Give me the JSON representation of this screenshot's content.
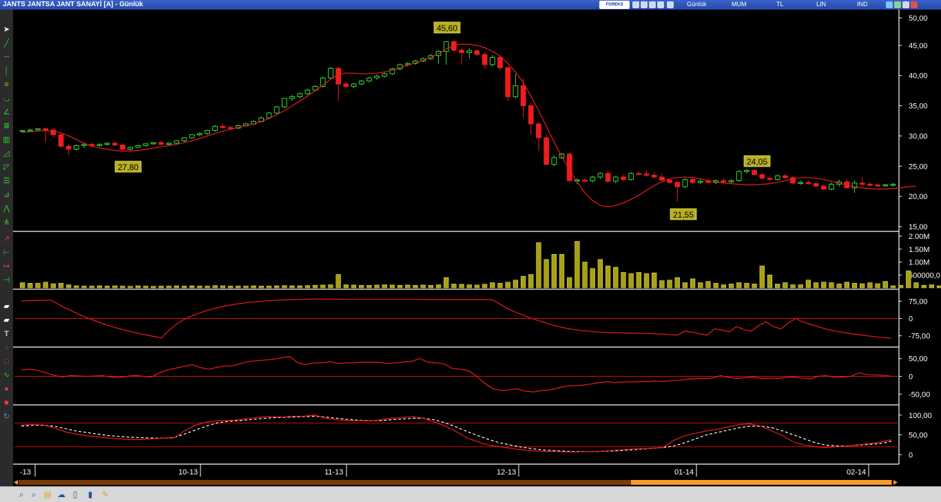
{
  "window": {
    "title": "JANTS JANTSA JANT SANAYİ [A] - Günlük",
    "brand": "FOREKS",
    "menu": [
      "Günlük",
      "MUM",
      "TL",
      "LIN",
      "IND"
    ]
  },
  "chart_data": {
    "type": "candlestick",
    "ylim": [
      15,
      50
    ],
    "price_ticks": [
      "50,00",
      "45,00",
      "40,00",
      "35,00",
      "30,00",
      "25,00",
      "20,00",
      "15,00"
    ],
    "x_ticks": [
      "-13",
      "10-13",
      "11-13",
      "12-13",
      "01-14",
      "02-14"
    ],
    "annotations": [
      "45,60",
      "27,80",
      "24,05",
      "21,55"
    ],
    "candles": [
      {
        "o": 30.8,
        "h": 31.0,
        "l": 30.5,
        "c": 30.9
      },
      {
        "o": 30.9,
        "h": 31.2,
        "l": 30.6,
        "c": 31.0
      },
      {
        "o": 31.0,
        "h": 31.3,
        "l": 30.8,
        "c": 31.2
      },
      {
        "o": 31.2,
        "h": 31.4,
        "l": 29.0,
        "c": 31.0
      },
      {
        "o": 31.0,
        "h": 31.3,
        "l": 29.8,
        "c": 30.2
      },
      {
        "o": 30.2,
        "h": 30.5,
        "l": 28.0,
        "c": 28.3
      },
      {
        "o": 28.3,
        "h": 28.6,
        "l": 26.8,
        "c": 27.8
      },
      {
        "o": 27.8,
        "h": 28.6,
        "l": 27.6,
        "c": 28.4
      },
      {
        "o": 28.4,
        "h": 28.8,
        "l": 28.0,
        "c": 28.6
      },
      {
        "o": 28.6,
        "h": 28.9,
        "l": 28.2,
        "c": 28.4
      },
      {
        "o": 28.4,
        "h": 28.8,
        "l": 28.2,
        "c": 28.6
      },
      {
        "o": 28.6,
        "h": 28.9,
        "l": 28.4,
        "c": 28.8
      },
      {
        "o": 28.8,
        "h": 29.2,
        "l": 28.3,
        "c": 28.5
      },
      {
        "o": 28.5,
        "h": 28.8,
        "l": 27.6,
        "c": 27.8
      },
      {
        "o": 27.8,
        "h": 28.3,
        "l": 27.6,
        "c": 28.1
      },
      {
        "o": 28.1,
        "h": 28.6,
        "l": 28.0,
        "c": 28.4
      },
      {
        "o": 28.4,
        "h": 28.8,
        "l": 28.2,
        "c": 28.7
      },
      {
        "o": 28.7,
        "h": 29.0,
        "l": 28.5,
        "c": 28.9
      },
      {
        "o": 28.9,
        "h": 29.2,
        "l": 28.5,
        "c": 28.6
      },
      {
        "o": 28.6,
        "h": 28.9,
        "l": 28.4,
        "c": 28.8
      },
      {
        "o": 28.8,
        "h": 29.3,
        "l": 28.7,
        "c": 29.2
      },
      {
        "o": 29.2,
        "h": 29.8,
        "l": 29.0,
        "c": 29.7
      },
      {
        "o": 29.7,
        "h": 30.3,
        "l": 29.5,
        "c": 30.2
      },
      {
        "o": 30.2,
        "h": 30.6,
        "l": 29.9,
        "c": 30.4
      },
      {
        "o": 30.4,
        "h": 31.0,
        "l": 30.2,
        "c": 30.9
      },
      {
        "o": 30.9,
        "h": 31.8,
        "l": 30.7,
        "c": 31.6
      },
      {
        "o": 31.6,
        "h": 32.0,
        "l": 31.2,
        "c": 31.4
      },
      {
        "o": 31.4,
        "h": 31.7,
        "l": 31.0,
        "c": 31.3
      },
      {
        "o": 31.3,
        "h": 31.9,
        "l": 31.1,
        "c": 31.7
      },
      {
        "o": 31.7,
        "h": 32.2,
        "l": 31.5,
        "c": 32.0
      },
      {
        "o": 32.0,
        "h": 32.6,
        "l": 31.8,
        "c": 32.4
      },
      {
        "o": 32.4,
        "h": 33.2,
        "l": 32.2,
        "c": 33.0
      },
      {
        "o": 33.0,
        "h": 34.0,
        "l": 32.8,
        "c": 33.8
      },
      {
        "o": 33.8,
        "h": 35.0,
        "l": 33.6,
        "c": 34.8
      },
      {
        "o": 34.8,
        "h": 36.3,
        "l": 34.6,
        "c": 36.2
      },
      {
        "o": 36.2,
        "h": 36.8,
        "l": 35.8,
        "c": 36.5
      },
      {
        "o": 36.5,
        "h": 37.2,
        "l": 36.2,
        "c": 37.0
      },
      {
        "o": 37.0,
        "h": 37.8,
        "l": 36.8,
        "c": 37.6
      },
      {
        "o": 37.6,
        "h": 38.4,
        "l": 37.4,
        "c": 38.2
      },
      {
        "o": 38.2,
        "h": 39.8,
        "l": 38.0,
        "c": 39.6
      },
      {
        "o": 39.6,
        "h": 41.4,
        "l": 39.4,
        "c": 41.2
      },
      {
        "o": 41.2,
        "h": 41.5,
        "l": 35.8,
        "c": 38.6
      },
      {
        "o": 38.6,
        "h": 39.0,
        "l": 37.8,
        "c": 38.2
      },
      {
        "o": 38.2,
        "h": 38.8,
        "l": 37.9,
        "c": 38.6
      },
      {
        "o": 38.6,
        "h": 39.3,
        "l": 38.4,
        "c": 39.1
      },
      {
        "o": 39.1,
        "h": 39.8,
        "l": 38.9,
        "c": 39.6
      },
      {
        "o": 39.6,
        "h": 40.2,
        "l": 39.3,
        "c": 39.9
      },
      {
        "o": 39.9,
        "h": 40.5,
        "l": 39.7,
        "c": 40.3
      },
      {
        "o": 40.3,
        "h": 41.3,
        "l": 40.1,
        "c": 41.1
      },
      {
        "o": 41.1,
        "h": 42.0,
        "l": 40.9,
        "c": 41.8
      },
      {
        "o": 41.8,
        "h": 42.3,
        "l": 41.5,
        "c": 42.0
      },
      {
        "o": 42.0,
        "h": 42.6,
        "l": 41.8,
        "c": 42.4
      },
      {
        "o": 42.4,
        "h": 43.0,
        "l": 42.2,
        "c": 42.8
      },
      {
        "o": 42.8,
        "h": 43.6,
        "l": 42.6,
        "c": 43.3
      },
      {
        "o": 43.3,
        "h": 44.2,
        "l": 42.0,
        "c": 44.0
      },
      {
        "o": 44.0,
        "h": 45.7,
        "l": 41.8,
        "c": 45.6
      },
      {
        "o": 45.6,
        "h": 45.8,
        "l": 43.8,
        "c": 44.2
      },
      {
        "o": 44.2,
        "h": 44.6,
        "l": 41.8,
        "c": 43.8
      },
      {
        "o": 43.8,
        "h": 44.5,
        "l": 42.8,
        "c": 44.1
      },
      {
        "o": 44.1,
        "h": 44.4,
        "l": 43.2,
        "c": 43.5
      },
      {
        "o": 43.5,
        "h": 43.8,
        "l": 41.2,
        "c": 41.8
      },
      {
        "o": 41.8,
        "h": 43.4,
        "l": 41.5,
        "c": 43.0
      },
      {
        "o": 43.0,
        "h": 43.3,
        "l": 40.8,
        "c": 41.3
      },
      {
        "o": 41.3,
        "h": 41.6,
        "l": 35.8,
        "c": 36.5
      },
      {
        "o": 36.5,
        "h": 40.3,
        "l": 36.2,
        "c": 38.3
      },
      {
        "o": 38.3,
        "h": 39.5,
        "l": 33.0,
        "c": 35.0
      },
      {
        "o": 35.0,
        "h": 35.5,
        "l": 30.2,
        "c": 32.0
      },
      {
        "o": 32.0,
        "h": 32.4,
        "l": 27.5,
        "c": 29.7
      },
      {
        "o": 29.7,
        "h": 30.2,
        "l": 25.2,
        "c": 25.3
      },
      {
        "o": 25.3,
        "h": 26.8,
        "l": 25.0,
        "c": 26.4
      },
      {
        "o": 26.4,
        "h": 27.2,
        "l": 26.2,
        "c": 27.0
      },
      {
        "o": 27.0,
        "h": 27.3,
        "l": 22.3,
        "c": 22.6
      },
      {
        "o": 22.6,
        "h": 23.0,
        "l": 22.0,
        "c": 22.7
      },
      {
        "o": 22.7,
        "h": 23.0,
        "l": 22.3,
        "c": 22.6
      },
      {
        "o": 22.6,
        "h": 23.4,
        "l": 22.3,
        "c": 23.2
      },
      {
        "o": 23.2,
        "h": 24.0,
        "l": 22.9,
        "c": 23.8
      },
      {
        "o": 23.8,
        "h": 24.2,
        "l": 22.2,
        "c": 22.5
      },
      {
        "o": 22.5,
        "h": 23.4,
        "l": 22.2,
        "c": 23.2
      },
      {
        "o": 23.2,
        "h": 23.6,
        "l": 22.5,
        "c": 22.8
      },
      {
        "o": 22.8,
        "h": 24.0,
        "l": 22.6,
        "c": 23.8
      },
      {
        "o": 23.8,
        "h": 24.1,
        "l": 23.5,
        "c": 23.7
      },
      {
        "o": 23.7,
        "h": 24.3,
        "l": 23.2,
        "c": 23.5
      },
      {
        "o": 23.5,
        "h": 24.0,
        "l": 23.0,
        "c": 23.2
      },
      {
        "o": 23.2,
        "h": 23.8,
        "l": 22.5,
        "c": 22.7
      },
      {
        "o": 22.7,
        "h": 23.0,
        "l": 22.0,
        "c": 22.3
      },
      {
        "o": 22.3,
        "h": 22.6,
        "l": 19.2,
        "c": 21.6
      },
      {
        "o": 21.6,
        "h": 23.0,
        "l": 21.4,
        "c": 22.8
      },
      {
        "o": 22.8,
        "h": 23.2,
        "l": 22.0,
        "c": 22.3
      },
      {
        "o": 22.3,
        "h": 22.8,
        "l": 22.0,
        "c": 22.5
      },
      {
        "o": 22.5,
        "h": 23.0,
        "l": 22.1,
        "c": 22.3
      },
      {
        "o": 22.3,
        "h": 22.8,
        "l": 22.0,
        "c": 22.6
      },
      {
        "o": 22.6,
        "h": 23.0,
        "l": 22.2,
        "c": 22.4
      },
      {
        "o": 22.4,
        "h": 22.8,
        "l": 22.1,
        "c": 22.6
      },
      {
        "o": 22.6,
        "h": 24.4,
        "l": 22.4,
        "c": 24.1
      },
      {
        "o": 24.1,
        "h": 24.5,
        "l": 23.8,
        "c": 24.3
      },
      {
        "o": 24.3,
        "h": 24.5,
        "l": 23.4,
        "c": 23.6
      },
      {
        "o": 23.6,
        "h": 23.9,
        "l": 22.8,
        "c": 23.0
      },
      {
        "o": 23.0,
        "h": 23.4,
        "l": 22.5,
        "c": 22.8
      },
      {
        "o": 22.8,
        "h": 23.6,
        "l": 22.6,
        "c": 23.4
      },
      {
        "o": 23.4,
        "h": 23.7,
        "l": 22.9,
        "c": 23.1
      },
      {
        "o": 23.1,
        "h": 23.4,
        "l": 22.0,
        "c": 22.2
      },
      {
        "o": 22.2,
        "h": 22.6,
        "l": 21.9,
        "c": 22.3
      },
      {
        "o": 22.3,
        "h": 22.6,
        "l": 21.9,
        "c": 22.1
      },
      {
        "o": 22.1,
        "h": 22.4,
        "l": 21.5,
        "c": 21.7
      },
      {
        "o": 21.7,
        "h": 21.9,
        "l": 21.0,
        "c": 21.2
      },
      {
        "o": 21.2,
        "h": 22.3,
        "l": 21.0,
        "c": 22.0
      },
      {
        "o": 22.0,
        "h": 22.8,
        "l": 21.6,
        "c": 22.4
      },
      {
        "o": 22.4,
        "h": 22.8,
        "l": 21.3,
        "c": 21.4
      },
      {
        "o": 21.4,
        "h": 22.6,
        "l": 20.6,
        "c": 22.2
      },
      {
        "o": 22.2,
        "h": 23.2,
        "l": 21.8,
        "c": 22.0
      },
      {
        "o": 22.0,
        "h": 22.4,
        "l": 21.6,
        "c": 21.9
      },
      {
        "o": 21.9,
        "h": 22.2,
        "l": 21.5,
        "c": 21.8
      },
      {
        "o": 21.8,
        "h": 22.1,
        "l": 21.6,
        "c": 21.9
      },
      {
        "o": 21.9,
        "h": 22.2,
        "l": 21.6,
        "c": 22.0
      }
    ],
    "moving_average": [
      30.6,
      30.7,
      30.8,
      30.9,
      30.8,
      30.5,
      30.0,
      29.4,
      28.8,
      28.3,
      28.0,
      27.8,
      27.6,
      27.5,
      27.5,
      27.6,
      27.8,
      28.0,
      28.2,
      28.4,
      28.6,
      28.9,
      29.2,
      29.6,
      30.0,
      30.4,
      30.8,
      31.1,
      31.4,
      31.7,
      32.0,
      32.4,
      32.9,
      33.5,
      34.2,
      35.0,
      35.8,
      36.6,
      37.5,
      38.4,
      39.4,
      40.2,
      40.4,
      40.4,
      40.3,
      40.3,
      40.4,
      40.6,
      40.9,
      41.3,
      41.7,
      42.1,
      42.5,
      43.0,
      43.6,
      44.4,
      45.0,
      45.2,
      45.2,
      45.0,
      44.6,
      44.0,
      43.2,
      42.0,
      40.6,
      38.8,
      36.6,
      34.2,
      31.6,
      29.0,
      26.6,
      24.4,
      22.4,
      20.6,
      19.3,
      18.5,
      18.3,
      18.5,
      18.9,
      19.5,
      20.2,
      21.0,
      21.8,
      22.4,
      22.9,
      23.1,
      23.2,
      23.1,
      22.9,
      22.6,
      22.4,
      22.2,
      22.1,
      22.0,
      21.9,
      21.9,
      22.0,
      22.1,
      22.3,
      22.6,
      22.9,
      23.1,
      23.1,
      23.0,
      22.8,
      22.5,
      22.2,
      21.9,
      21.6,
      21.4,
      21.3,
      21.2,
      21.2,
      21.3,
      21.4,
      21.6,
      21.7
    ],
    "volume": {
      "ticks": [
        "2.00M",
        "1.50M",
        "1.00M",
        "500000,0"
      ],
      "ylim": [
        0,
        2.0
      ],
      "values": [
        0.2,
        0.18,
        0.18,
        0.22,
        0.16,
        0.18,
        0.12,
        0.08,
        0.07,
        0.07,
        0.08,
        0.07,
        0.08,
        0.07,
        0.06,
        0.08,
        0.07,
        0.06,
        0.07,
        0.07,
        0.08,
        0.07,
        0.08,
        0.07,
        0.07,
        0.09,
        0.08,
        0.07,
        0.07,
        0.07,
        0.08,
        0.07,
        0.07,
        0.08,
        0.09,
        0.08,
        0.08,
        0.09,
        0.1,
        0.11,
        0.12,
        0.52,
        0.12,
        0.11,
        0.1,
        0.1,
        0.11,
        0.12,
        0.11,
        0.1,
        0.11,
        0.1,
        0.11,
        0.1,
        0.12,
        0.4,
        0.15,
        0.14,
        0.12,
        0.11,
        0.14,
        0.2,
        0.18,
        0.22,
        0.3,
        0.45,
        0.52,
        1.75,
        1.1,
        1.3,
        1.3,
        0.4,
        1.8,
        1.0,
        0.75,
        1.1,
        0.85,
        0.8,
        0.6,
        0.55,
        0.6,
        0.55,
        0.58,
        0.28,
        0.3,
        0.4,
        0.2,
        0.35,
        0.2,
        0.25,
        0.18,
        0.12,
        0.15,
        0.2,
        0.18,
        0.15,
        0.85,
        0.5,
        0.15,
        0.2,
        0.12,
        0.12,
        0.3,
        0.2,
        0.22,
        0.2,
        0.15,
        0.22,
        0.18,
        0.16,
        0.2,
        0.16,
        0.25,
        0.08,
        0.1,
        0.66,
        0.2,
        0.1,
        0.12,
        0.08
      ]
    },
    "indicator1": {
      "ticks": [
        "75,00",
        "0",
        "-75,00"
      ],
      "ylim": [
        -100,
        100
      ],
      "levels": [
        0
      ],
      "values": [
        76,
        77,
        78,
        79,
        80,
        62,
        45,
        30,
        15,
        2,
        -10,
        -22,
        -32,
        -42,
        -50,
        -58,
        -65,
        -72,
        -78,
        -84,
        -52,
        -25,
        -5,
        10,
        22,
        33,
        42,
        50,
        56,
        62,
        66,
        70,
        73,
        76,
        78,
        80,
        81,
        82,
        83,
        84,
        84,
        84,
        84,
        84,
        83,
        83,
        83,
        83,
        83,
        83,
        83,
        83,
        83,
        83,
        83,
        82,
        82,
        82,
        82,
        82,
        82,
        82,
        82,
        82,
        80,
        60,
        42,
        28,
        15,
        3,
        -8,
        -18,
        -28,
        -36,
        -43,
        -48,
        -52,
        -55,
        -58,
        -60,
        -61,
        -62,
        -63,
        -63,
        -64,
        -65,
        -67,
        -68,
        -70,
        -72,
        -55,
        -60,
        -66,
        -72,
        -45,
        -50,
        -58,
        -35,
        -48,
        -55,
        -30,
        -15,
        -35,
        -45,
        -20,
        0,
        -15,
        -25,
        -35,
        -45,
        -52,
        -58,
        -63,
        -68,
        -72,
        -76,
        -80,
        -83,
        -86
      ]
    },
    "indicator2": {
      "ticks": [
        "50,00",
        "0",
        "-50,00"
      ],
      "ylim": [
        -65,
        65
      ],
      "levels": [
        0
      ],
      "values": [
        18,
        20,
        17,
        10,
        3,
        -2,
        2,
        1,
        0,
        1,
        2,
        -2,
        -3,
        0,
        3,
        0,
        -2,
        10,
        18,
        23,
        28,
        33,
        25,
        20,
        25,
        29,
        30,
        36,
        42,
        44,
        46,
        48,
        52,
        56,
        38,
        33,
        38,
        38,
        41,
        36,
        38,
        38,
        40,
        40,
        39,
        36,
        38,
        40,
        42,
        50,
        40,
        38,
        35,
        22,
        20,
        16,
        0,
        -20,
        -35,
        -40,
        -38,
        -35,
        -42,
        -44,
        -40,
        -38,
        -33,
        -28,
        -26,
        -25,
        -22,
        -18,
        -15,
        -18,
        -16,
        -16,
        -15,
        -15,
        -13,
        -14,
        -12,
        -11,
        -8,
        -6,
        -6,
        -5,
        2,
        -3,
        -6,
        -4,
        -2,
        -6,
        -5,
        -6,
        -3,
        -2,
        -5,
        -7,
        0,
        2,
        -3,
        -2,
        0,
        10,
        5,
        4,
        3,
        0
      ]
    },
    "indicator3": {
      "ticks": [
        "100,00",
        "50,00",
        "0"
      ],
      "ylim": [
        -10,
        110
      ],
      "levels": [
        80,
        20
      ],
      "k": [
        75,
        76,
        75,
        68,
        58,
        52,
        48,
        45,
        42,
        40,
        38,
        38,
        40,
        42,
        42,
        60,
        74,
        82,
        86,
        86,
        88,
        92,
        95,
        96,
        95,
        97,
        97,
        100,
        92,
        88,
        86,
        86,
        85,
        88,
        92,
        94,
        96,
        92,
        82,
        72,
        58,
        42,
        32,
        24,
        20,
        16,
        12,
        10,
        8,
        8,
        7,
        7,
        8,
        8,
        10,
        12,
        14,
        15,
        16,
        18,
        36,
        48,
        54,
        60,
        64,
        70,
        76,
        78,
        72,
        60,
        48,
        32,
        24,
        20,
        18,
        20,
        22,
        25,
        28,
        32,
        38
      ],
      "d": [
        72,
        74,
        74,
        72,
        66,
        60,
        56,
        52,
        48,
        46,
        44,
        43,
        42,
        42,
        43,
        52,
        62,
        72,
        80,
        84,
        86,
        88,
        91,
        93,
        94,
        95,
        96,
        97,
        95,
        92,
        89,
        87,
        86,
        86,
        88,
        90,
        92,
        92,
        88,
        80,
        70,
        58,
        48,
        38,
        30,
        24,
        19,
        15,
        12,
        10,
        9,
        8,
        8,
        8,
        9,
        10,
        12,
        14,
        16,
        18,
        22,
        30,
        40,
        50,
        56,
        62,
        68,
        72,
        72,
        68,
        60,
        50,
        40,
        30,
        24,
        22,
        22,
        24,
        26,
        28,
        34
      ]
    }
  }
}
